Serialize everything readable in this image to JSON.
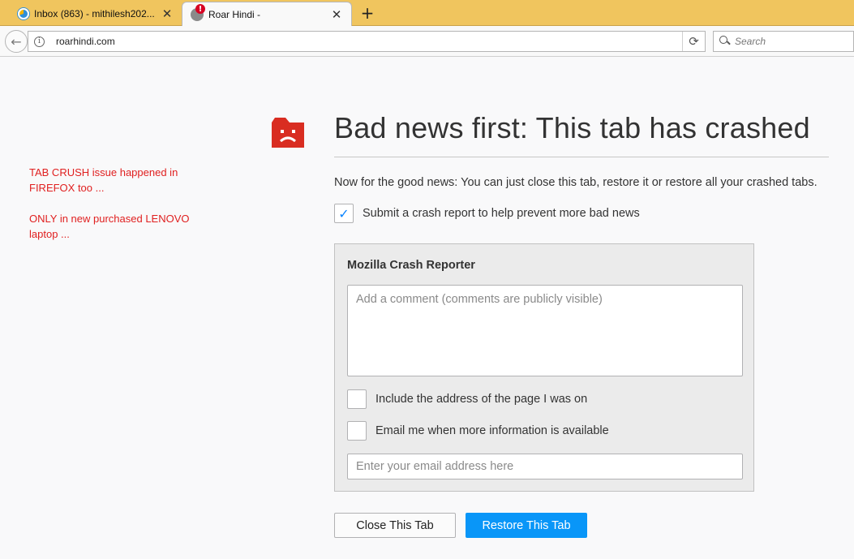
{
  "tabs": [
    {
      "label": "Inbox (863) - mithilesh202...",
      "favicon": "inbox-favicon"
    },
    {
      "label": "Roar Hindi -",
      "favicon": "crash-warning-favicon",
      "badge": "!"
    }
  ],
  "tab_close_glyph": "✕",
  "new_tab_glyph": "+",
  "navbar": {
    "back_glyph": "←",
    "info_glyph": "i",
    "url": "roarhindi.com",
    "reload_glyph": "⟳",
    "search_placeholder": "Search"
  },
  "notes": {
    "line1": "TAB CRUSH issue happened in FIREFOX too ...",
    "line2": "ONLY in new purchased LENOVO laptop ..."
  },
  "crash": {
    "title": "Bad news first: This tab has crashed",
    "good_news": "Now for the good news: You can just close this tab, restore it or restore all your crashed tabs.",
    "submit_label": "Submit a crash report to help prevent more bad news",
    "submit_checked": true,
    "check_glyph": "✓",
    "reporter_title": "Mozilla Crash Reporter",
    "comment_placeholder": "Add a comment (comments are publicly visible)",
    "include_url_label": "Include the address of the page I was on",
    "email_me_label": "Email me when more information is available",
    "email_placeholder": "Enter your email address here",
    "close_button": "Close This Tab",
    "restore_button": "Restore This Tab"
  },
  "colors": {
    "tabstrip": "#f0c55e",
    "note_text": "#e02020",
    "crash_icon": "#d92d21",
    "restore_button": "#0996f8",
    "checkmark": "#0a84ff"
  }
}
